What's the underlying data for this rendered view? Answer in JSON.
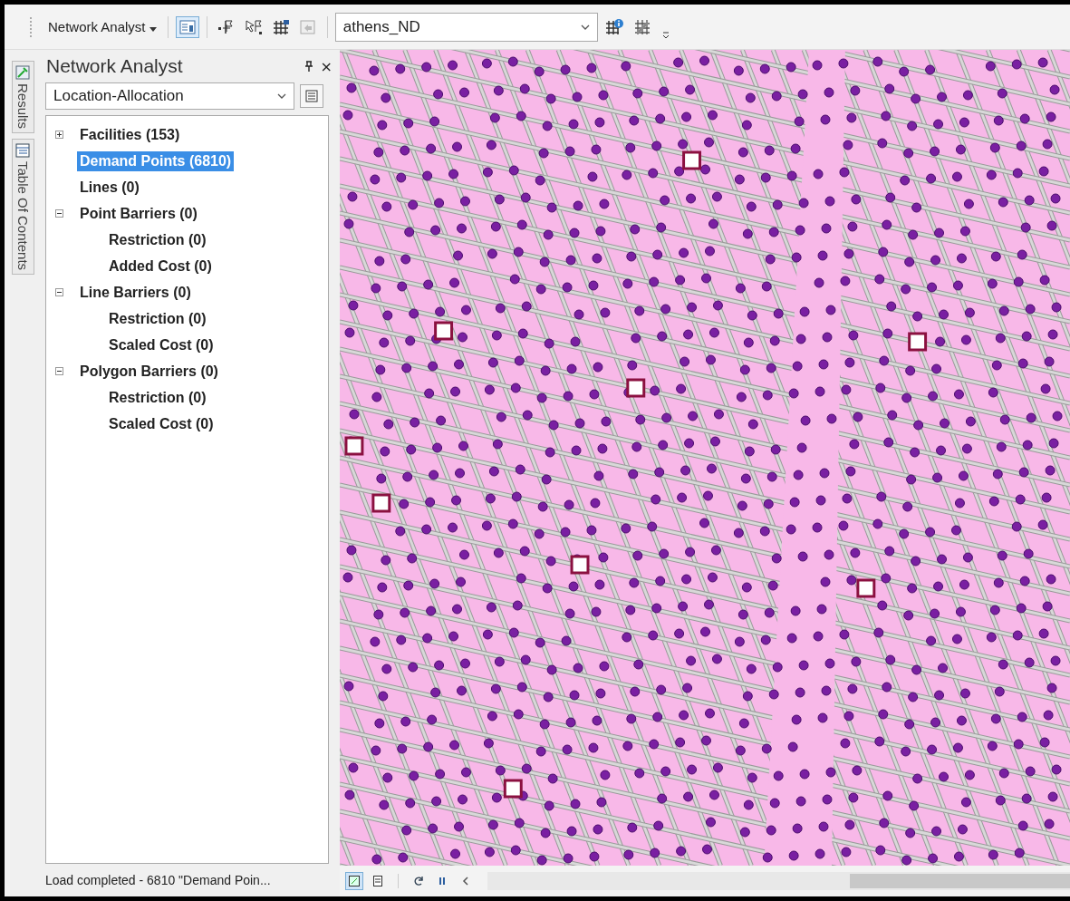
{
  "toolbar": {
    "menu_label": "Network Analyst",
    "network_dataset": "athens_ND"
  },
  "side_tabs": [
    {
      "label": "Results",
      "selected": false
    },
    {
      "label": "Table Of Contents",
      "selected": false
    }
  ],
  "panel": {
    "title": "Network Analyst",
    "close": "×",
    "analysis_layer": "Location-Allocation",
    "tree": [
      {
        "label": "Facilities (153)",
        "selected": false,
        "expanded": false
      },
      {
        "label": "Demand Points (6810)",
        "selected": true
      },
      {
        "label": "Lines (0)",
        "selected": false
      },
      {
        "label": "Point Barriers (0)",
        "selected": false,
        "expanded": true,
        "children": [
          {
            "label": "Restriction (0)",
            "selected": false
          },
          {
            "label": "Added Cost (0)",
            "selected": false
          }
        ]
      },
      {
        "label": "Line Barriers (0)",
        "selected": false,
        "expanded": true,
        "children": [
          {
            "label": "Restriction (0)",
            "selected": false
          },
          {
            "label": "Scaled Cost (0)",
            "selected": false
          }
        ]
      },
      {
        "label": "Polygon Barriers (0)",
        "selected": false,
        "expanded": true,
        "children": [
          {
            "label": "Restriction (0)",
            "selected": false
          },
          {
            "label": "Scaled Cost (0)",
            "selected": false
          }
        ]
      }
    ],
    "status": "Load completed - 6810 \"Demand Poin..."
  },
  "map_toolbar": {
    "views": [
      {
        "kind": "data",
        "selected": true
      },
      {
        "kind": "layout",
        "selected": false
      }
    ]
  }
}
